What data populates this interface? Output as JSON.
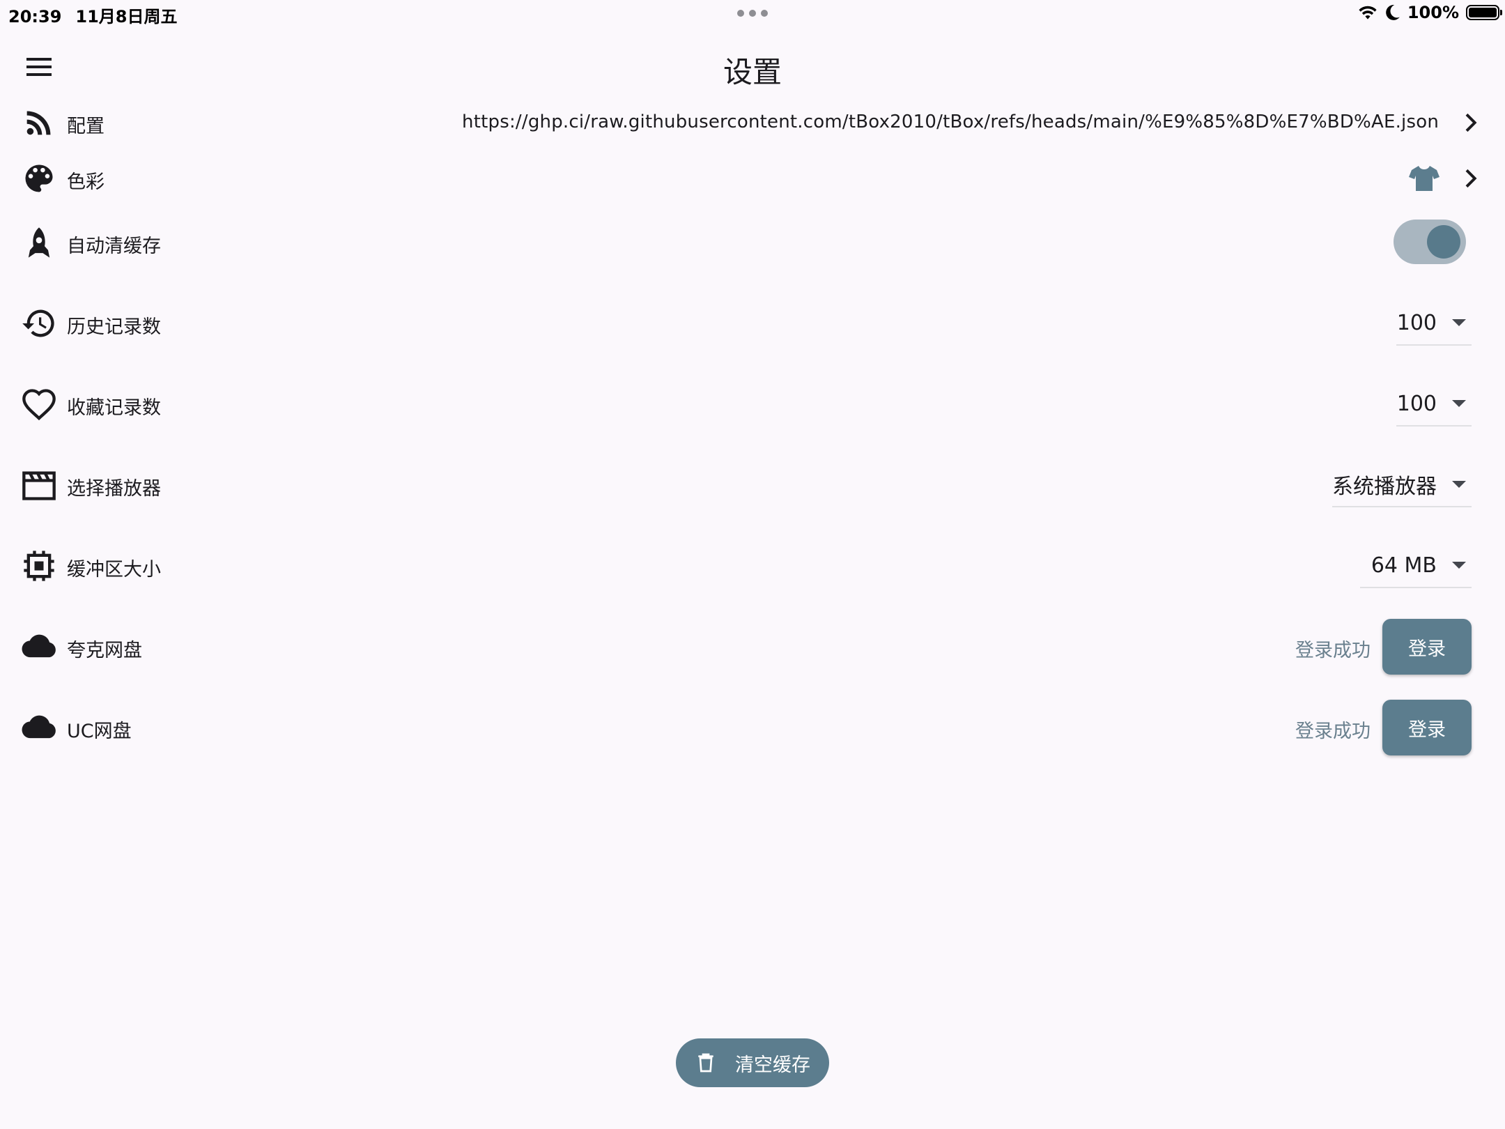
{
  "status_bar": {
    "time": "20:39",
    "date": "11月8日周五",
    "battery": "100%"
  },
  "app_bar": {
    "title": "设置",
    "menu_icon": "menu-icon"
  },
  "settings": {
    "config": {
      "label": "配置",
      "value": "https://ghp.ci/raw.githubusercontent.com/tBox2010/tBox/refs/heads/main/%E9%85%8D%E7%BD%AE.json",
      "icon": "rss-feed-icon"
    },
    "color": {
      "label": "色彩",
      "icon": "palette-icon",
      "value_icon": "tshirt-icon"
    },
    "auto_clear": {
      "label": "自动清缓存",
      "icon": "rocket-icon",
      "enabled": true
    },
    "history_count": {
      "label": "历史记录数",
      "value": "100",
      "icon": "history-icon"
    },
    "favorite_count": {
      "label": "收藏记录数",
      "value": "100",
      "icon": "heart-icon"
    },
    "player": {
      "label": "选择播放器",
      "value": "系统播放器",
      "icon": "movie-icon"
    },
    "buffer_size": {
      "label": "缓冲区大小",
      "value": "64 MB",
      "icon": "memory-chip-icon"
    },
    "quark": {
      "label": "夸克网盘",
      "status": "登录成功",
      "button": "登录",
      "icon": "cloud-icon"
    },
    "uc": {
      "label": "UC网盘",
      "status": "登录成功",
      "button": "登录",
      "icon": "cloud-icon"
    }
  },
  "fab": {
    "label": "清空缓存",
    "icon": "trash-icon"
  },
  "colors": {
    "background": "#FBF8FC",
    "accent": "#5C7D8E",
    "toggle_track": "#A9B6C0",
    "status_text": "#6A808E"
  }
}
